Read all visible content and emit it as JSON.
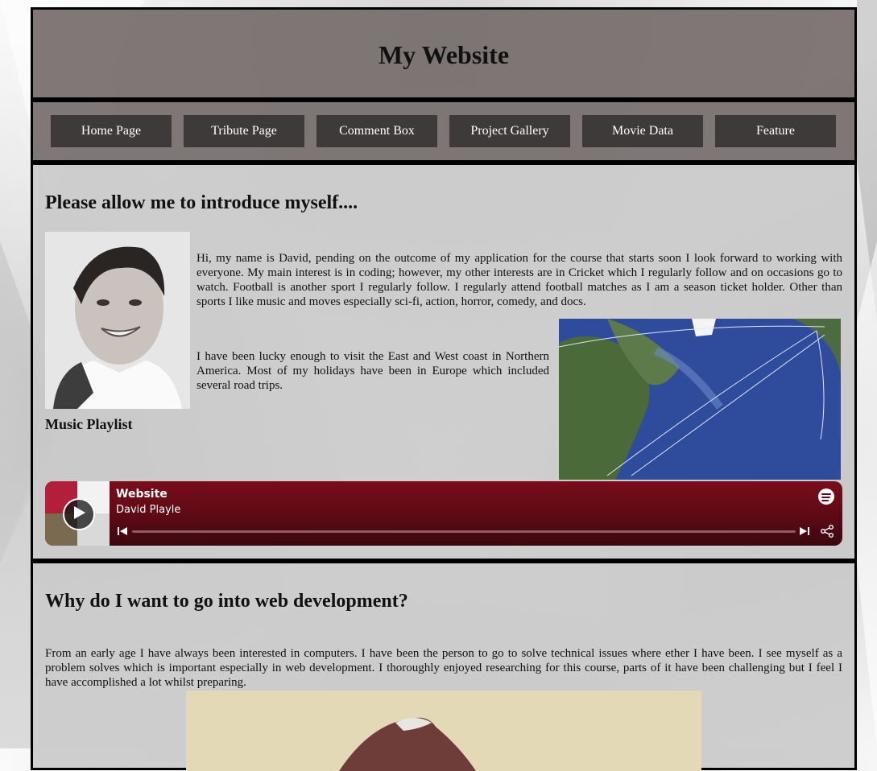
{
  "header": {
    "title": "My Website"
  },
  "nav": {
    "items": [
      {
        "label": "Home Page"
      },
      {
        "label": "Tribute Page"
      },
      {
        "label": "Comment Box"
      },
      {
        "label": "Project Gallery"
      },
      {
        "label": "Movie Data"
      },
      {
        "label": "Feature"
      }
    ]
  },
  "about": {
    "heading": "Please allow me to introduce myself....",
    "paragraph1": "Hi, my name is David, pending on the outcome of my application for the course that starts soon I look forward to working with everyone. My main interest is in coding; however, my other interests are in Cricket which I regularly follow and on occasions go to watch. Football is another sport I regularly follow. I regularly attend football matches as I am a season ticket holder. Other than sports I like music and moves especially sci-fi, action, horror, comedy, and docs.",
    "paragraph2": "I have been lucky enough to visit the East and West coast in Northern America. Most of my holidays have been in Europe which included several road trips.",
    "playlist_heading": "Music Playlist"
  },
  "player": {
    "title": "Website",
    "artist": "David Playle",
    "colors": {
      "background": "#6b0c18",
      "text": "#ffffff"
    }
  },
  "why": {
    "heading": "Why do I want to go into web development?",
    "paragraph": "From an early age I have always been interested in computers. I have been the person to go to solve technical issues where ether I have been. I see myself as a problem solves which is important especially in web development. I thoroughly enjoyed researching for this course, parts of it have been challenging but I feel I have accomplished a lot whilst preparing."
  }
}
